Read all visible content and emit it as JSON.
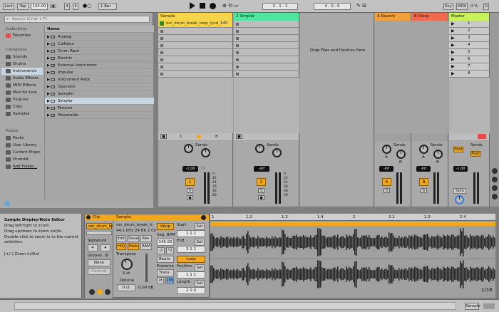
{
  "topbar": {
    "link": "Link",
    "tap": "Tap",
    "tempo": "135.00",
    "sig_num": "4",
    "sig_den": "4",
    "quantize": "1 Bar",
    "position": "3 .  1 .  1",
    "loop_len": "4 .  0 .  0",
    "key": "Key",
    "midi": "MIDI",
    "pct": "0 %",
    "d": "D"
  },
  "browser": {
    "search_placeholder": "Search (Cmd + F)",
    "collections_title": "Collections",
    "favorites": "Favorites",
    "categories_title": "Categories",
    "categories": [
      "Sounds",
      "Drums",
      "Instruments",
      "Audio Effects",
      "MIDI Effects",
      "Max for Live",
      "Plug-ins",
      "Clips",
      "Samples"
    ],
    "places_title": "Places",
    "places": [
      "Packs",
      "User Library",
      "Current Projec",
      "Drumkit",
      "Add Folder..."
    ],
    "name_header": "Name",
    "items": [
      "Analog",
      "Collision",
      "Drum Rack",
      "Electric",
      "External Instrument",
      "Impulse",
      "Instrument Rack",
      "Operator",
      "Sampler",
      "Simpler",
      "Tension",
      "Wavetable"
    ]
  },
  "session": {
    "tracks": [
      {
        "name": "Sample",
        "color": "#f7d54a",
        "clip": "osr_drum_break_loop_lynd_145",
        "vol": "-1.00",
        "num": "1"
      },
      {
        "name": "2 Simpler",
        "color": "#50e6a0",
        "vol": "-inf",
        "num": "2"
      },
      {
        "name": "A Reverb",
        "color": "#f2a03d",
        "vol": "-inf",
        "num": "A"
      },
      {
        "name": "B Delay",
        "color": "#f06a4e",
        "vol": "-inf",
        "num": "B"
      },
      {
        "name": "Master",
        "color": "#c8f25a",
        "vol": "-1.00"
      }
    ],
    "drop_text": "Drop Files and Devices Here",
    "scenes": [
      "1",
      "2",
      "3",
      "4",
      "5",
      "6",
      "7",
      "8"
    ],
    "sends_label": "Sends",
    "knob_a": "A",
    "knob_b": "B",
    "post": "Post",
    "solo": "Solo",
    "s_label": "S",
    "io_1": "1",
    "io_8": "8",
    "db_scale": [
      "0",
      "12",
      "24",
      "36",
      "48",
      "60"
    ]
  },
  "info": {
    "title": "Sample Display/Note Editor",
    "lines": [
      "Drag left/right to scroll.",
      "Drag up/down to zoom out/in.",
      "Double-click to zoom in to the current selection.",
      "",
      "[+/-] Zoom In/Out"
    ]
  },
  "clip": {
    "clip_tab": "Clip",
    "name": "osr_drum_br",
    "signature": "Signature",
    "sig_a": "4",
    "sig_b": "4",
    "groove": "Groove",
    "groove_val": "None",
    "commit": "Commit",
    "sample_tab": "Sample",
    "sample_name": "osr_drum_break_lc",
    "sample_info": "44.1 kHz 24 Bit 2 Ch",
    "edit": "Edit",
    "save": "Save",
    "rev": "Rev.",
    "hiq": "HiQ",
    "fade": "Fade",
    "ram": "RAM",
    "warp": "Warp",
    "seg_bpm": "Seg. BPM",
    "bpm": "145.00",
    "half": ":2",
    "dbl": "*2",
    "transpose": "Transpose",
    "transpose_val": "0 st",
    "detune": "Detune",
    "detune_val": "0 ct",
    "gain": "0.00 dB",
    "beats": "Beats",
    "preserve": "Preserve",
    "trans": "Trans",
    "start": "Start",
    "start_v": "1  1  1",
    "end": "End",
    "end_v": "3  1  1",
    "loop": "Loop",
    "position": "Position",
    "pos_v": "1  1  1",
    "length": "Length",
    "len_v": "2  0  0",
    "set": "Set",
    "val_100": "100"
  },
  "wave": {
    "ruler": [
      "1",
      "1.2",
      "1.3",
      "1.4",
      "2",
      "2.2",
      "2.3",
      "2.4"
    ],
    "zoom": "1/16"
  },
  "status": {
    "track_label": "Sample"
  }
}
